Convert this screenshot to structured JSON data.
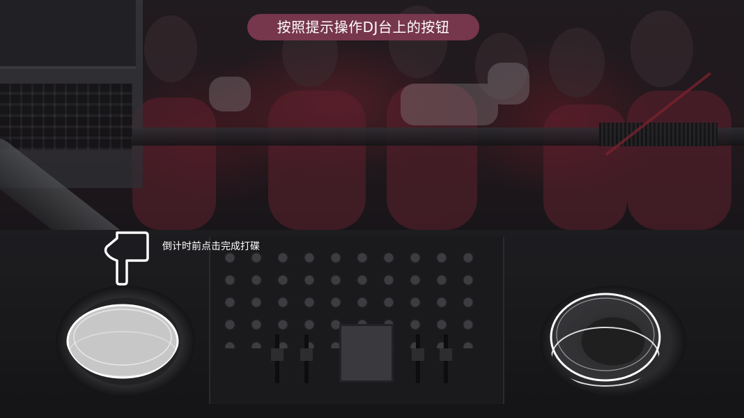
{
  "header": {
    "title": "按照提示操作DJ台上的按钮"
  },
  "hint": {
    "text": "倒计时前点击完成打碟"
  },
  "icons": {
    "pointer": "hand-pointer-down-icon"
  },
  "colors": {
    "title_bg": "#803a50",
    "title_text": "#ffffff",
    "hint_text": "#ffffff",
    "disc_active_fill": "#d9d9d9",
    "disc_outline": "#ffffff"
  }
}
